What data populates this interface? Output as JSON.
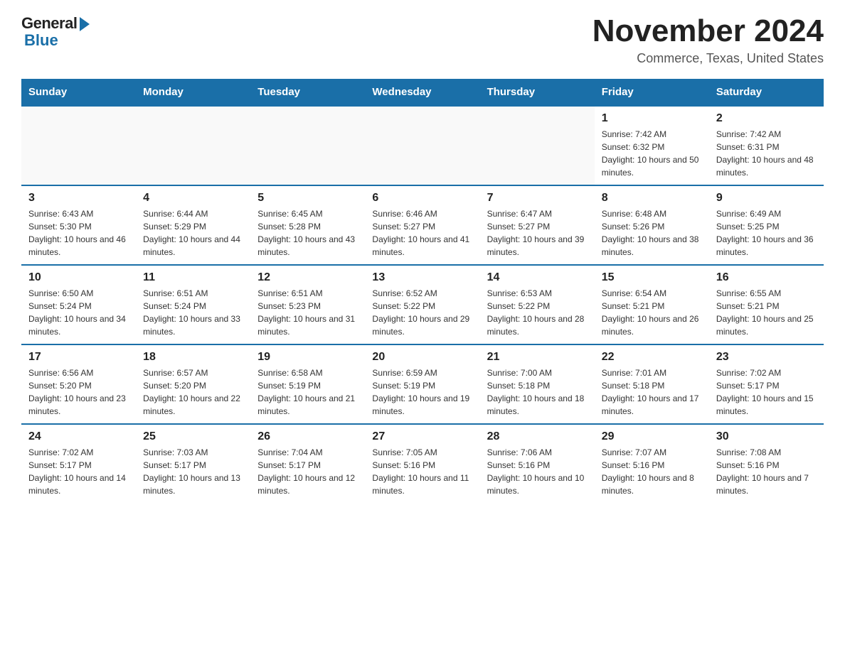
{
  "logo": {
    "general": "General",
    "blue": "Blue"
  },
  "title": {
    "month_year": "November 2024",
    "location": "Commerce, Texas, United States"
  },
  "days_of_week": [
    "Sunday",
    "Monday",
    "Tuesday",
    "Wednesday",
    "Thursday",
    "Friday",
    "Saturday"
  ],
  "weeks": [
    [
      {
        "day": "",
        "sunrise": "",
        "sunset": "",
        "daylight": "",
        "empty": true
      },
      {
        "day": "",
        "sunrise": "",
        "sunset": "",
        "daylight": "",
        "empty": true
      },
      {
        "day": "",
        "sunrise": "",
        "sunset": "",
        "daylight": "",
        "empty": true
      },
      {
        "day": "",
        "sunrise": "",
        "sunset": "",
        "daylight": "",
        "empty": true
      },
      {
        "day": "",
        "sunrise": "",
        "sunset": "",
        "daylight": "",
        "empty": true
      },
      {
        "day": "1",
        "sunrise": "Sunrise: 7:42 AM",
        "sunset": "Sunset: 6:32 PM",
        "daylight": "Daylight: 10 hours and 50 minutes.",
        "empty": false
      },
      {
        "day": "2",
        "sunrise": "Sunrise: 7:42 AM",
        "sunset": "Sunset: 6:31 PM",
        "daylight": "Daylight: 10 hours and 48 minutes.",
        "empty": false
      }
    ],
    [
      {
        "day": "3",
        "sunrise": "Sunrise: 6:43 AM",
        "sunset": "Sunset: 5:30 PM",
        "daylight": "Daylight: 10 hours and 46 minutes.",
        "empty": false
      },
      {
        "day": "4",
        "sunrise": "Sunrise: 6:44 AM",
        "sunset": "Sunset: 5:29 PM",
        "daylight": "Daylight: 10 hours and 44 minutes.",
        "empty": false
      },
      {
        "day": "5",
        "sunrise": "Sunrise: 6:45 AM",
        "sunset": "Sunset: 5:28 PM",
        "daylight": "Daylight: 10 hours and 43 minutes.",
        "empty": false
      },
      {
        "day": "6",
        "sunrise": "Sunrise: 6:46 AM",
        "sunset": "Sunset: 5:27 PM",
        "daylight": "Daylight: 10 hours and 41 minutes.",
        "empty": false
      },
      {
        "day": "7",
        "sunrise": "Sunrise: 6:47 AM",
        "sunset": "Sunset: 5:27 PM",
        "daylight": "Daylight: 10 hours and 39 minutes.",
        "empty": false
      },
      {
        "day": "8",
        "sunrise": "Sunrise: 6:48 AM",
        "sunset": "Sunset: 5:26 PM",
        "daylight": "Daylight: 10 hours and 38 minutes.",
        "empty": false
      },
      {
        "day": "9",
        "sunrise": "Sunrise: 6:49 AM",
        "sunset": "Sunset: 5:25 PM",
        "daylight": "Daylight: 10 hours and 36 minutes.",
        "empty": false
      }
    ],
    [
      {
        "day": "10",
        "sunrise": "Sunrise: 6:50 AM",
        "sunset": "Sunset: 5:24 PM",
        "daylight": "Daylight: 10 hours and 34 minutes.",
        "empty": false
      },
      {
        "day": "11",
        "sunrise": "Sunrise: 6:51 AM",
        "sunset": "Sunset: 5:24 PM",
        "daylight": "Daylight: 10 hours and 33 minutes.",
        "empty": false
      },
      {
        "day": "12",
        "sunrise": "Sunrise: 6:51 AM",
        "sunset": "Sunset: 5:23 PM",
        "daylight": "Daylight: 10 hours and 31 minutes.",
        "empty": false
      },
      {
        "day": "13",
        "sunrise": "Sunrise: 6:52 AM",
        "sunset": "Sunset: 5:22 PM",
        "daylight": "Daylight: 10 hours and 29 minutes.",
        "empty": false
      },
      {
        "day": "14",
        "sunrise": "Sunrise: 6:53 AM",
        "sunset": "Sunset: 5:22 PM",
        "daylight": "Daylight: 10 hours and 28 minutes.",
        "empty": false
      },
      {
        "day": "15",
        "sunrise": "Sunrise: 6:54 AM",
        "sunset": "Sunset: 5:21 PM",
        "daylight": "Daylight: 10 hours and 26 minutes.",
        "empty": false
      },
      {
        "day": "16",
        "sunrise": "Sunrise: 6:55 AM",
        "sunset": "Sunset: 5:21 PM",
        "daylight": "Daylight: 10 hours and 25 minutes.",
        "empty": false
      }
    ],
    [
      {
        "day": "17",
        "sunrise": "Sunrise: 6:56 AM",
        "sunset": "Sunset: 5:20 PM",
        "daylight": "Daylight: 10 hours and 23 minutes.",
        "empty": false
      },
      {
        "day": "18",
        "sunrise": "Sunrise: 6:57 AM",
        "sunset": "Sunset: 5:20 PM",
        "daylight": "Daylight: 10 hours and 22 minutes.",
        "empty": false
      },
      {
        "day": "19",
        "sunrise": "Sunrise: 6:58 AM",
        "sunset": "Sunset: 5:19 PM",
        "daylight": "Daylight: 10 hours and 21 minutes.",
        "empty": false
      },
      {
        "day": "20",
        "sunrise": "Sunrise: 6:59 AM",
        "sunset": "Sunset: 5:19 PM",
        "daylight": "Daylight: 10 hours and 19 minutes.",
        "empty": false
      },
      {
        "day": "21",
        "sunrise": "Sunrise: 7:00 AM",
        "sunset": "Sunset: 5:18 PM",
        "daylight": "Daylight: 10 hours and 18 minutes.",
        "empty": false
      },
      {
        "day": "22",
        "sunrise": "Sunrise: 7:01 AM",
        "sunset": "Sunset: 5:18 PM",
        "daylight": "Daylight: 10 hours and 17 minutes.",
        "empty": false
      },
      {
        "day": "23",
        "sunrise": "Sunrise: 7:02 AM",
        "sunset": "Sunset: 5:17 PM",
        "daylight": "Daylight: 10 hours and 15 minutes.",
        "empty": false
      }
    ],
    [
      {
        "day": "24",
        "sunrise": "Sunrise: 7:02 AM",
        "sunset": "Sunset: 5:17 PM",
        "daylight": "Daylight: 10 hours and 14 minutes.",
        "empty": false
      },
      {
        "day": "25",
        "sunrise": "Sunrise: 7:03 AM",
        "sunset": "Sunset: 5:17 PM",
        "daylight": "Daylight: 10 hours and 13 minutes.",
        "empty": false
      },
      {
        "day": "26",
        "sunrise": "Sunrise: 7:04 AM",
        "sunset": "Sunset: 5:17 PM",
        "daylight": "Daylight: 10 hours and 12 minutes.",
        "empty": false
      },
      {
        "day": "27",
        "sunrise": "Sunrise: 7:05 AM",
        "sunset": "Sunset: 5:16 PM",
        "daylight": "Daylight: 10 hours and 11 minutes.",
        "empty": false
      },
      {
        "day": "28",
        "sunrise": "Sunrise: 7:06 AM",
        "sunset": "Sunset: 5:16 PM",
        "daylight": "Daylight: 10 hours and 10 minutes.",
        "empty": false
      },
      {
        "day": "29",
        "sunrise": "Sunrise: 7:07 AM",
        "sunset": "Sunset: 5:16 PM",
        "daylight": "Daylight: 10 hours and 8 minutes.",
        "empty": false
      },
      {
        "day": "30",
        "sunrise": "Sunrise: 7:08 AM",
        "sunset": "Sunset: 5:16 PM",
        "daylight": "Daylight: 10 hours and 7 minutes.",
        "empty": false
      }
    ]
  ]
}
